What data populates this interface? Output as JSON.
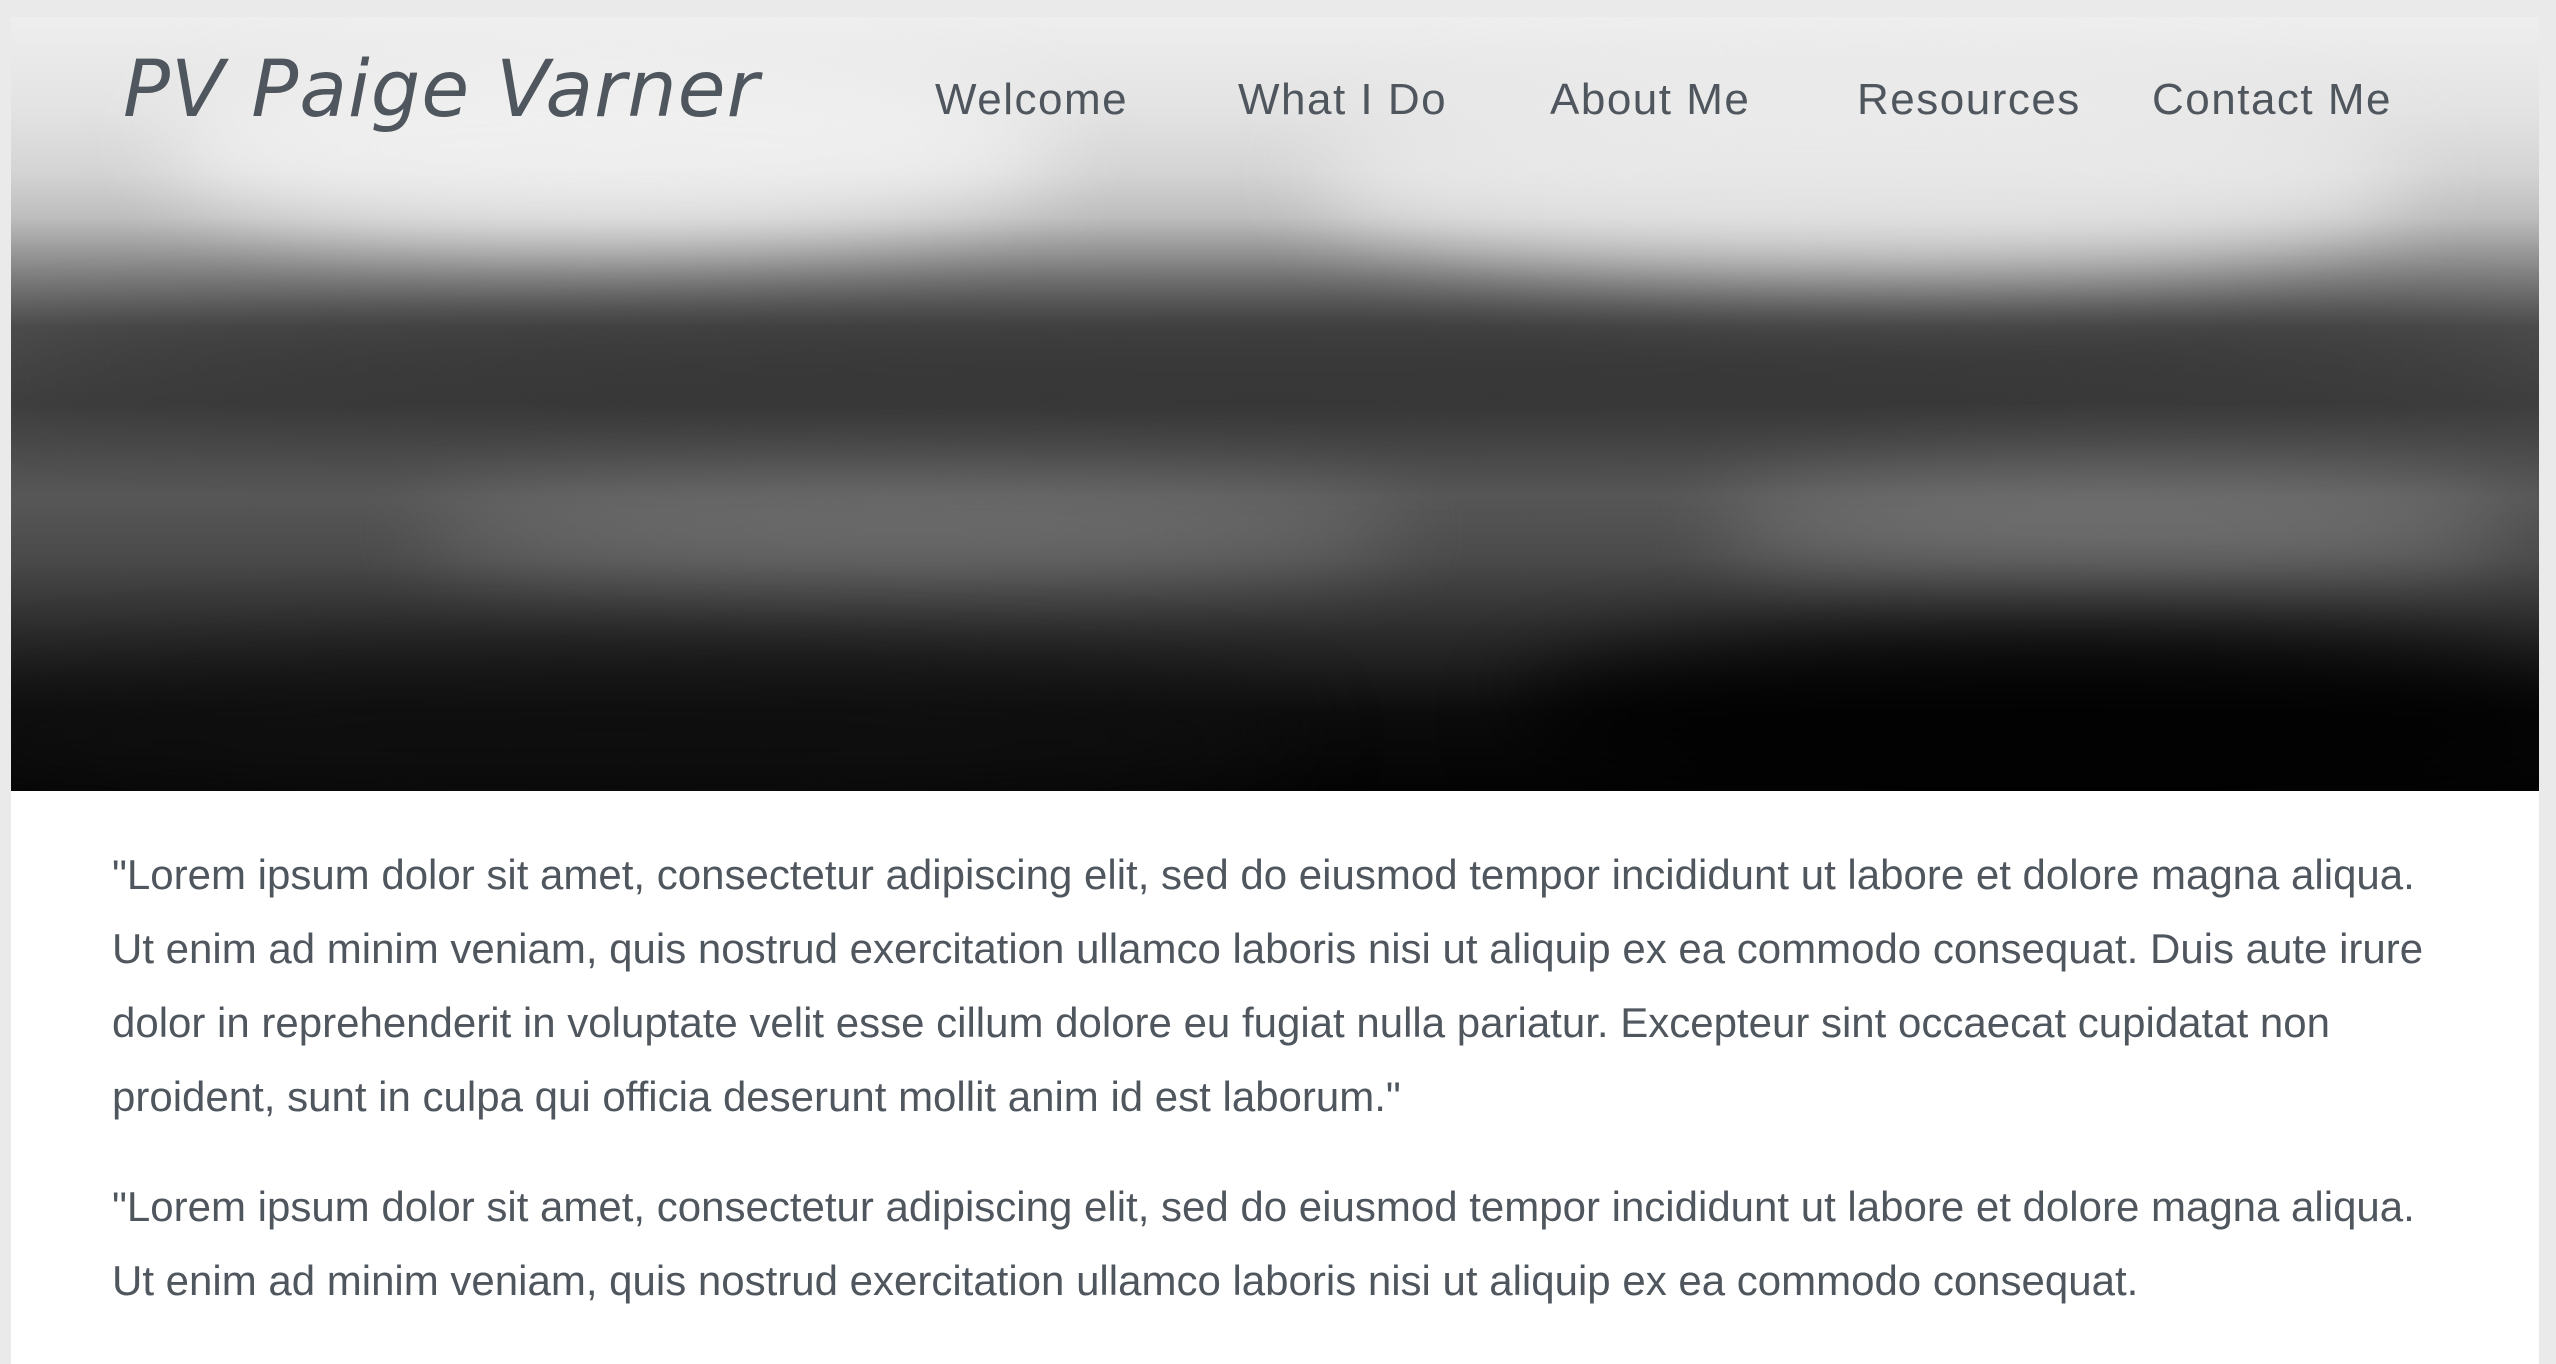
{
  "site": {
    "logo_text": "PV Paige Varner"
  },
  "nav": {
    "items": [
      {
        "label": "Welcome"
      },
      {
        "label": "What I Do"
      },
      {
        "label": "About Me"
      },
      {
        "label": "Resources"
      },
      {
        "label": "Contact Me"
      }
    ]
  },
  "hero": {
    "description_icon": "blurred-landscape-image"
  },
  "content": {
    "paragraphs": [
      "\"Lorem ipsum dolor sit amet, consectetur adipiscing elit, sed do eiusmod tempor incididunt ut labore et dolore magna aliqua. Ut enim ad minim veniam, quis nostrud exercitation ullamco laboris nisi ut aliquip ex ea commodo consequat. Duis aute irure dolor in reprehenderit in voluptate velit esse cillum dolore eu fugiat nulla pariatur. Excepteur sint occaecat cupidatat non proident, sunt in culpa qui officia deserunt mollit anim id est laborum.\"",
      "\"Lorem ipsum dolor sit amet, consectetur adipiscing elit, sed do eiusmod tempor incididunt ut labore et dolore magna aliqua. Ut enim ad minim veniam, quis nostrud exercitation ullamco laboris nisi ut aliquip ex ea commodo consequat."
    ]
  },
  "colors": {
    "text": "#4f565d",
    "background": "#ffffff",
    "frame": "#eaeaea"
  }
}
